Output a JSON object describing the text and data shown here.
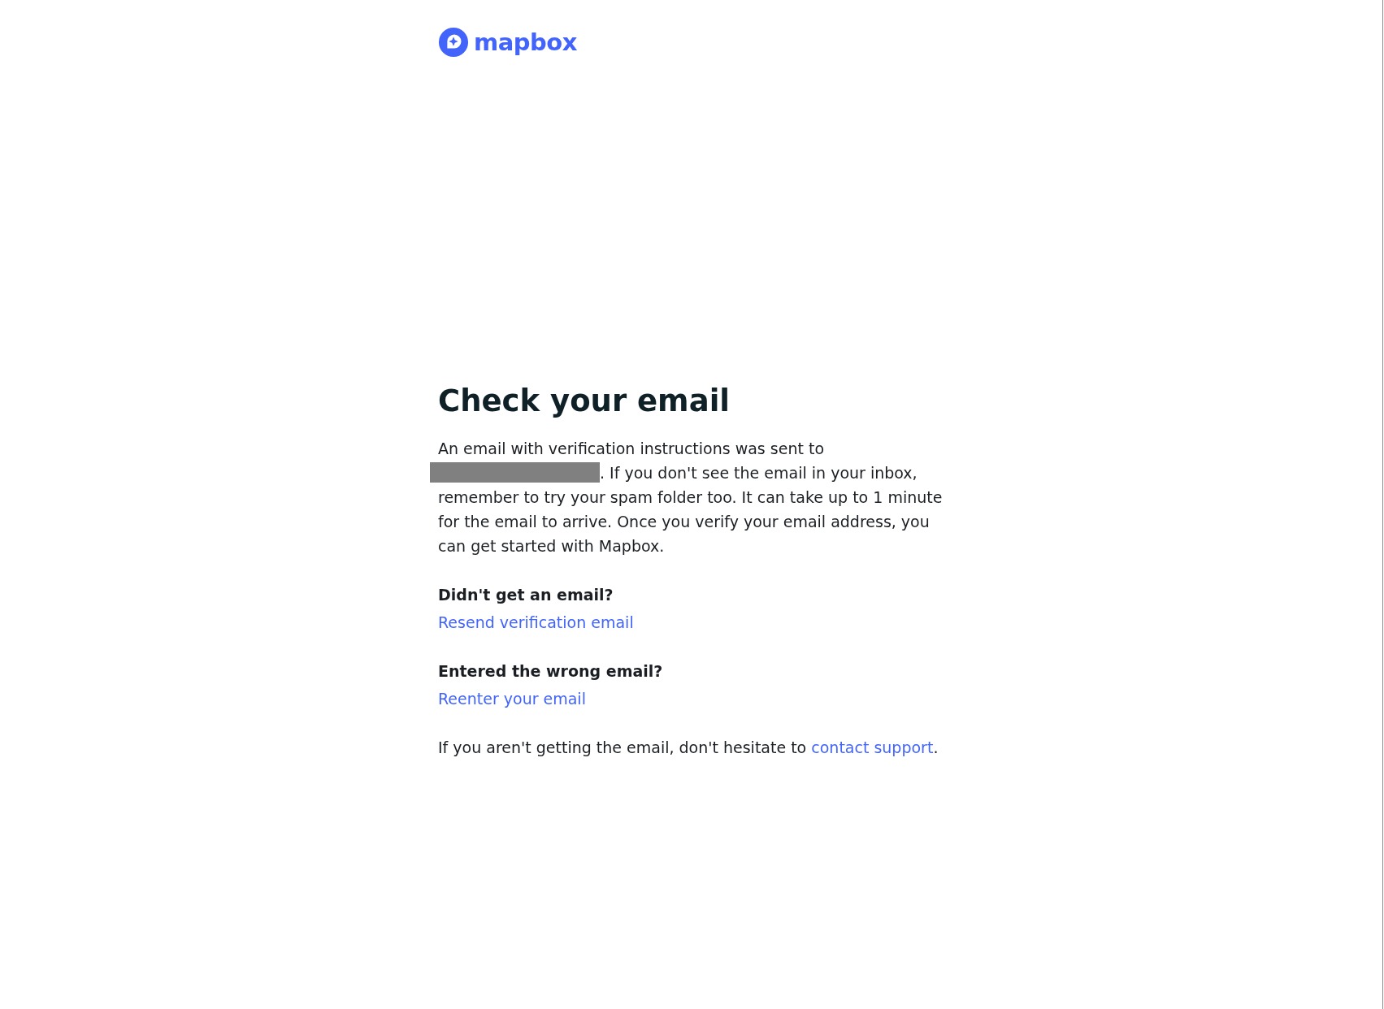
{
  "logo": {
    "wordmark": "mapbox"
  },
  "heading": "Check your email",
  "message": {
    "before": "An email with verification instructions was sent to",
    "redacted": true,
    "after": ". If you don't see the email in your inbox, remember to try your spam folder too. It can take up to 1 minute for the email to arrive. Once you verify your email address, you can get started with Mapbox."
  },
  "sections": [
    {
      "question": "Didn't get an email?",
      "link": "Resend verification email"
    },
    {
      "question": "Entered the wrong email?",
      "link": "Reenter your email"
    }
  ],
  "footer": {
    "text": "If you aren't getting the email, don't hesitate to",
    "link": "contact support",
    "end": "."
  }
}
